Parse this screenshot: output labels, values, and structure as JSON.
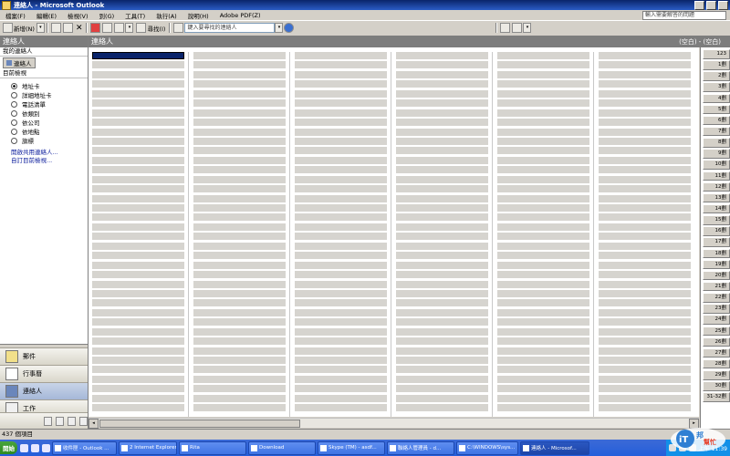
{
  "window": {
    "title": "連絡人 - Microsoft Outlook"
  },
  "menu": {
    "items": [
      "檔案(F)",
      "編輯(E)",
      "檢視(V)",
      "到(G)",
      "工具(T)",
      "執行(A)",
      "說明(H)",
      "Adobe PDF(Z)"
    ],
    "help_placeholder": "輸入需要解答的問題"
  },
  "toolbar": {
    "new_label": "新增(N)",
    "find_label": "尋找(I)",
    "search_placeholder": "鍵入要尋找的連絡人"
  },
  "nav": {
    "header": "連絡人",
    "my_contacts": "我的連絡人",
    "folder": "連絡人",
    "current_view": "目前檢視",
    "views": [
      {
        "label": "地址卡",
        "selected": true
      },
      {
        "label": "詳細地址卡",
        "selected": false
      },
      {
        "label": "電話清單",
        "selected": false
      },
      {
        "label": "依類別",
        "selected": false
      },
      {
        "label": "依公司",
        "selected": false
      },
      {
        "label": "依地點",
        "selected": false
      },
      {
        "label": "旗標",
        "selected": false
      }
    ],
    "links": [
      "開啟共用連絡人...",
      "自訂目前檢視..."
    ],
    "modules": [
      "郵件",
      "行事曆",
      "連絡人",
      "工作"
    ]
  },
  "main": {
    "header": "連絡人",
    "range": "(空白) - (空白)"
  },
  "index": [
    "123",
    "1劃",
    "2劃",
    "3劃",
    "4劃",
    "5劃",
    "6劃",
    "7劃",
    "8劃",
    "9劃",
    "10劃",
    "11劃",
    "12劃",
    "13劃",
    "14劃",
    "15劃",
    "16劃",
    "17劃",
    "18劃",
    "19劃",
    "20劃",
    "21劃",
    "22劃",
    "23劃",
    "24劃",
    "25劃",
    "26劃",
    "27劃",
    "28劃",
    "29劃",
    "30劃",
    "31-32劃"
  ],
  "status": {
    "count": "437 個項目"
  },
  "taskbar": {
    "start": "開始",
    "tasks": [
      "收件匣 - Outlook ...",
      "2 Internet Explorer",
      "Rita",
      "Download",
      "Skype (TM) - asdf...",
      "聯絡人管理員 - d...",
      "C:\\WINDOWS\\sys...",
      "連絡人 - Microsof..."
    ],
    "clock": "上午 11:39"
  },
  "colors": {
    "title_bar": "#0a246a",
    "pane_header": "#7d7d7d",
    "card_bar": "#d6d4cf",
    "selection": "#0a246a"
  }
}
